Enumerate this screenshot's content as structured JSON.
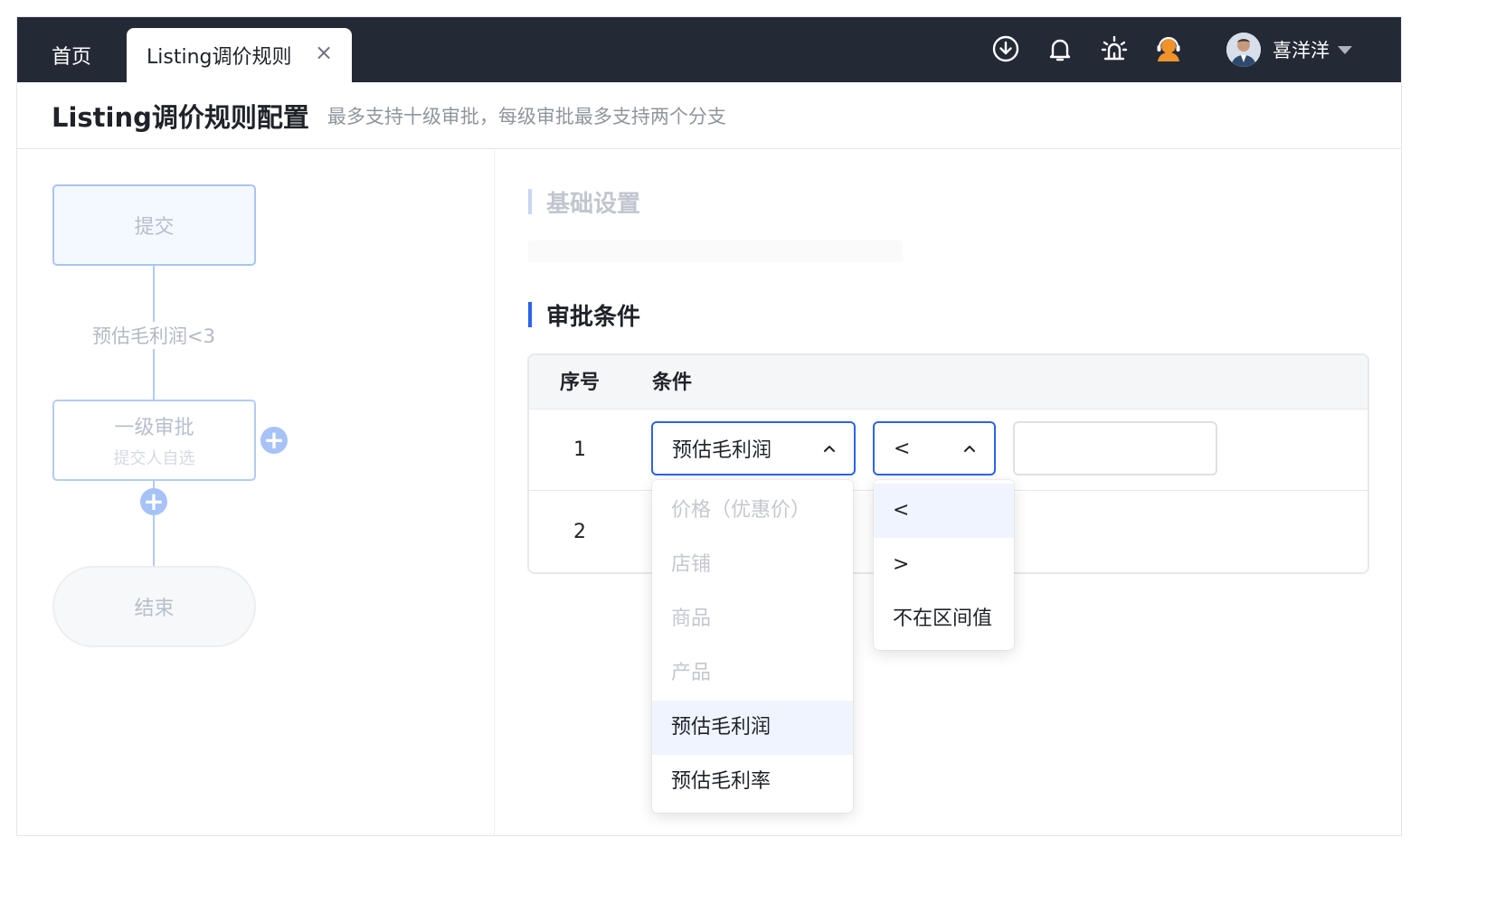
{
  "header": {
    "tabs": [
      {
        "label": "首页",
        "active": false
      },
      {
        "label": "Listing调价规则",
        "active": true
      }
    ],
    "tab_close": "×",
    "icons": [
      "download-icon",
      "bell-icon",
      "alarm-icon",
      "support-icon"
    ],
    "user": {
      "name": "喜洋洋"
    }
  },
  "page": {
    "title": "Listing调价规则配置",
    "subtitle": "最多支持十级审批，每级审批最多支持两个分支"
  },
  "flow": {
    "start_node": "提交",
    "condition_label": "预估毛利润<3",
    "approval_node": {
      "title": "一级审批",
      "subtitle": "提交人自选"
    },
    "end_node": "结束",
    "add_symbol": "+"
  },
  "basic_settings": {
    "title": "基础设置"
  },
  "conditions": {
    "title": "审批条件",
    "columns": [
      "序号",
      "条件"
    ],
    "rows": [
      {
        "index": "1",
        "field": "预估毛利润",
        "operator": "<",
        "value": ""
      },
      {
        "index": "2"
      }
    ],
    "field_options": [
      {
        "label": "价格（优惠价）",
        "disabled": true
      },
      {
        "label": "店铺",
        "disabled": true
      },
      {
        "label": "商品",
        "disabled": true
      },
      {
        "label": "产品",
        "disabled": true
      },
      {
        "label": "预估毛利润",
        "selected": true
      },
      {
        "label": "预估毛利率"
      }
    ],
    "operator_options": [
      {
        "label": "<",
        "selected": true
      },
      {
        "label": ">"
      },
      {
        "label": "不在区间值"
      }
    ]
  },
  "colors": {
    "topbar": "#242936",
    "accent": "#2a64ea",
    "flow_border": "#a9c4f4"
  }
}
